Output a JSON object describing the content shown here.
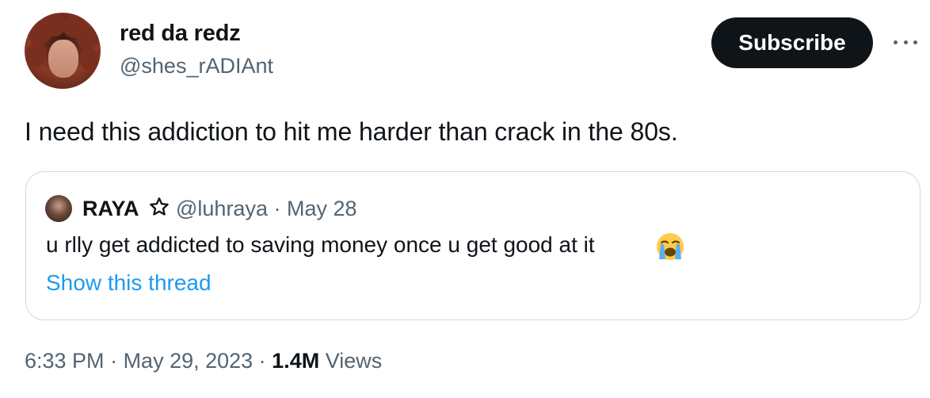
{
  "author": {
    "display_name": "red da redz",
    "handle": "@shes_rADIAnt"
  },
  "actions": {
    "subscribe_label": "Subscribe",
    "more_icon": "more-horizontal-icon"
  },
  "tweet": {
    "text": "I need this addiction to hit me harder than crack in the 80s."
  },
  "quoted_tweet": {
    "display_name": "RAYA",
    "badge_icon": "star-outline-icon",
    "meta": "@luhraya · May 28",
    "text": "u rlly get addicted to saving money once u get good at it",
    "emoji_icon": "loudly-crying-face-icon",
    "show_thread_label": "Show this thread"
  },
  "footer": {
    "time": "6:33 PM",
    "separator": " · ",
    "date": "May 29, 2023",
    "views_count": "1.4M",
    "views_label": " Views"
  },
  "colors": {
    "text_primary": "#0f1419",
    "text_secondary": "#536471",
    "link": "#1d9bf0",
    "border": "#cfd9de",
    "button_bg": "#0f1419"
  }
}
